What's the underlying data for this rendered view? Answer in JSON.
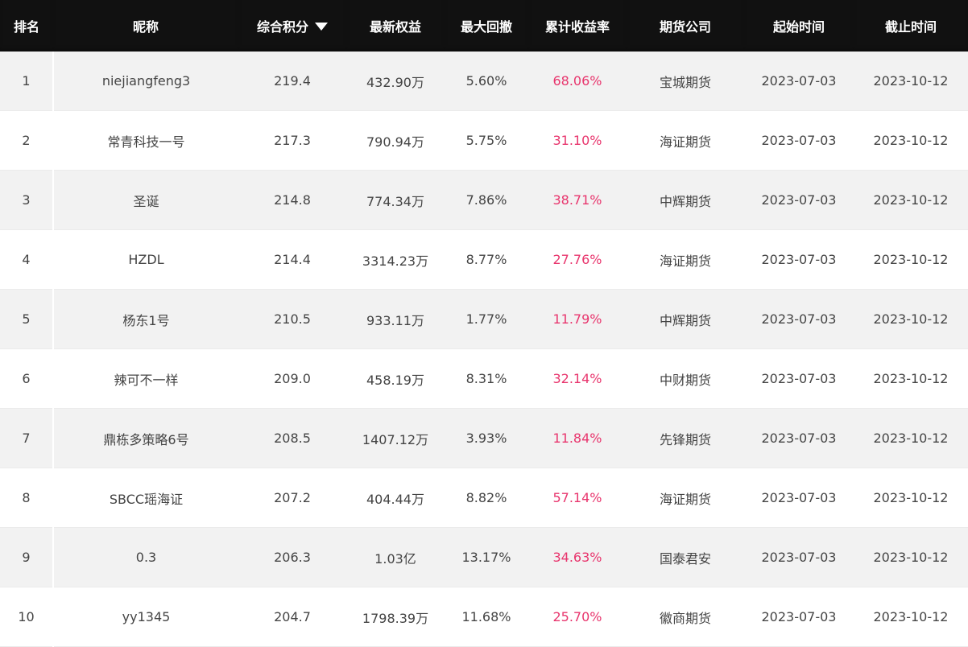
{
  "table": {
    "headers": {
      "rank": "排名",
      "nickname": "昵称",
      "score": "综合积分",
      "equity": "最新权益",
      "drawdown": "最大回撤",
      "return": "累计收益率",
      "company": "期货公司",
      "start": "起始时间",
      "end": "截止时间"
    },
    "sort_icon": "triangle-down-icon",
    "colors": {
      "header_bg": "#111111",
      "return_text": "#e8356d",
      "stripe_bg": "#f2f2f2"
    },
    "rows": [
      {
        "rank": "1",
        "nickname": "niejiangfeng3",
        "score": "219.4",
        "equity": "432.90万",
        "drawdown": "5.60%",
        "return": "68.06%",
        "company": "宝城期货",
        "start": "2023-07-03",
        "end": "2023-10-12"
      },
      {
        "rank": "2",
        "nickname": "常青科技一号",
        "score": "217.3",
        "equity": "790.94万",
        "drawdown": "5.75%",
        "return": "31.10%",
        "company": "海证期货",
        "start": "2023-07-03",
        "end": "2023-10-12"
      },
      {
        "rank": "3",
        "nickname": "圣诞",
        "score": "214.8",
        "equity": "774.34万",
        "drawdown": "7.86%",
        "return": "38.71%",
        "company": "中辉期货",
        "start": "2023-07-03",
        "end": "2023-10-12"
      },
      {
        "rank": "4",
        "nickname": "HZDL",
        "score": "214.4",
        "equity": "3314.23万",
        "drawdown": "8.77%",
        "return": "27.76%",
        "company": "海证期货",
        "start": "2023-07-03",
        "end": "2023-10-12"
      },
      {
        "rank": "5",
        "nickname": "杨东1号",
        "score": "210.5",
        "equity": "933.11万",
        "drawdown": "1.77%",
        "return": "11.79%",
        "company": "中辉期货",
        "start": "2023-07-03",
        "end": "2023-10-12"
      },
      {
        "rank": "6",
        "nickname": "辣可不一样",
        "score": "209.0",
        "equity": "458.19万",
        "drawdown": "8.31%",
        "return": "32.14%",
        "company": "中财期货",
        "start": "2023-07-03",
        "end": "2023-10-12"
      },
      {
        "rank": "7",
        "nickname": "鼎栋多策略6号",
        "score": "208.5",
        "equity": "1407.12万",
        "drawdown": "3.93%",
        "return": "11.84%",
        "company": "先锋期货",
        "start": "2023-07-03",
        "end": "2023-10-12"
      },
      {
        "rank": "8",
        "nickname": "SBCC瑶海证",
        "score": "207.2",
        "equity": "404.44万",
        "drawdown": "8.82%",
        "return": "57.14%",
        "company": "海证期货",
        "start": "2023-07-03",
        "end": "2023-10-12"
      },
      {
        "rank": "9",
        "nickname": "0.3",
        "score": "206.3",
        "equity": "1.03亿",
        "drawdown": "13.17%",
        "return": "34.63%",
        "company": "国泰君安",
        "start": "2023-07-03",
        "end": "2023-10-12"
      },
      {
        "rank": "10",
        "nickname": "yy1345",
        "score": "204.7",
        "equity": "1798.39万",
        "drawdown": "11.68%",
        "return": "25.70%",
        "company": "徽商期货",
        "start": "2023-07-03",
        "end": "2023-10-12"
      }
    ]
  }
}
